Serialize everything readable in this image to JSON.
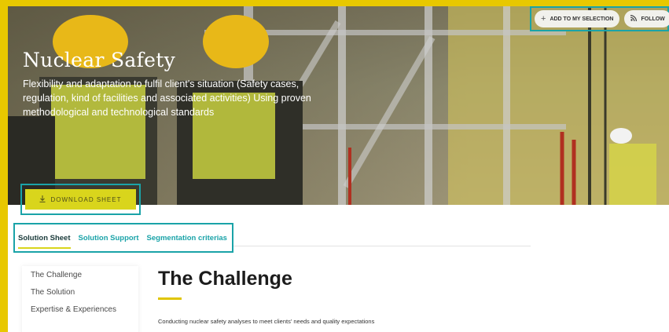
{
  "hero": {
    "title": "Nuclear Safety",
    "description": "Flexibility and adaptation to fulfil client's situation (Safety cases, regulation, kind of facilities and associated activities) Using proven methodological and technological standards",
    "download_label": "DOWNLOAD SHEET",
    "add_selection_label": "ADD TO MY SELECTION",
    "follow_label": "FOLLOW"
  },
  "tabs": [
    {
      "label": "Solution Sheet"
    },
    {
      "label": "Solution Support"
    },
    {
      "label": "Segmentation criterias"
    }
  ],
  "sidebar": {
    "items": [
      {
        "label": "The Challenge"
      },
      {
        "label": "The Solution"
      },
      {
        "label": "Expertise & Experiences"
      }
    ]
  },
  "main": {
    "title": "The Challenge",
    "text": "Conducting nuclear safety analyses to meet clients' needs and quality expectations"
  },
  "colors": {
    "accent_teal": "#1aa3a8",
    "accent_yellow": "#d9d51c",
    "frame_yellow": "#e8c800"
  },
  "icons": [
    "plus-icon",
    "rss-icon",
    "download-icon"
  ]
}
